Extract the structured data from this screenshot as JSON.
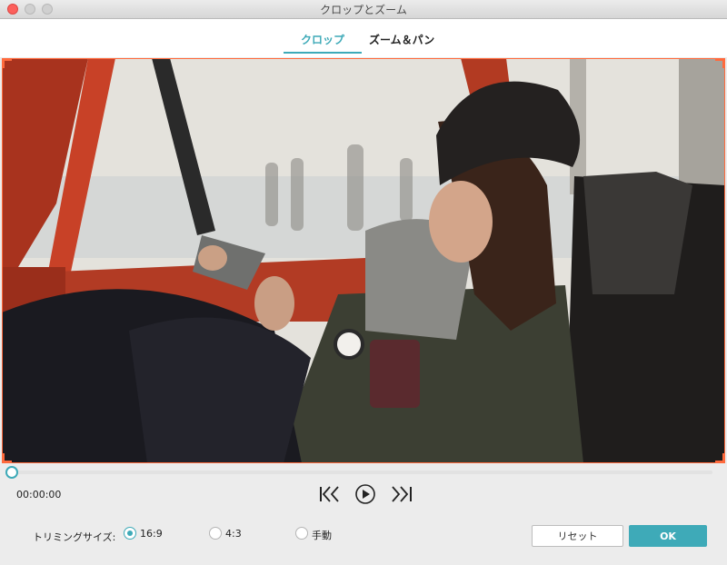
{
  "window": {
    "title": "クロップとズーム"
  },
  "tabs": [
    {
      "label": "クロップ",
      "active": true
    },
    {
      "label": "ズーム＆パン",
      "active": false
    }
  ],
  "player": {
    "time": "00:00:00",
    "progress": 0,
    "icons": {
      "prev": "skip-to-start-icon",
      "play": "play-icon",
      "next": "skip-to-end-icon"
    }
  },
  "trim": {
    "label": "トリミングサイズ:",
    "options": [
      {
        "label": "16:9",
        "selected": true
      },
      {
        "label": "4:3",
        "selected": false
      },
      {
        "label": "手動",
        "selected": false
      }
    ]
  },
  "buttons": {
    "reset": "リセット",
    "ok": "OK"
  },
  "colors": {
    "accent": "#3eaab8",
    "crop_frame": "#ff6a3d",
    "close": "#fc605c"
  }
}
